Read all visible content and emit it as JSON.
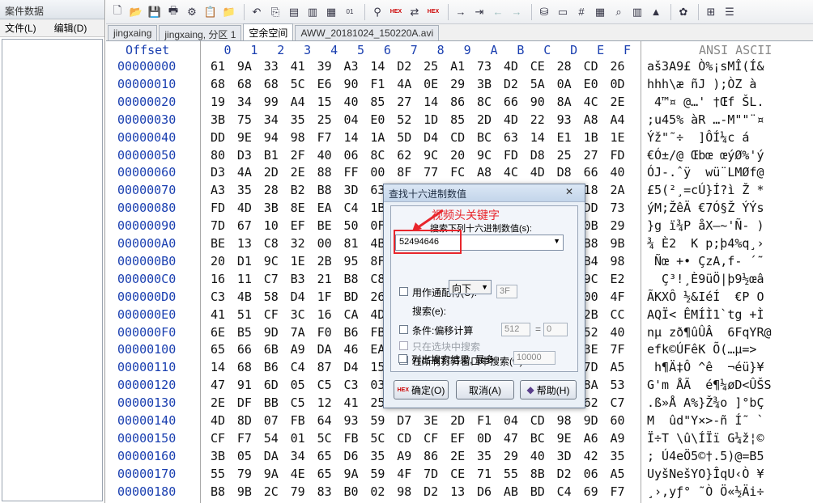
{
  "left_panel": {
    "title": "案件数据",
    "menu": [
      "文件(L)",
      "编辑(D)"
    ]
  },
  "tabs": [
    {
      "label": "jingxaing",
      "active": false
    },
    {
      "label": "jingxaing, 分区 1",
      "active": false
    },
    {
      "label": "空余空间",
      "active": true
    },
    {
      "label": "AWW_20181024_150220A.avi",
      "active": false
    }
  ],
  "hex_view": {
    "offset_header": "Offset",
    "column_headers": [
      "0",
      "1",
      "2",
      "3",
      "4",
      "5",
      "6",
      "7",
      "8",
      "9",
      "A",
      "B",
      "C",
      "D",
      "E",
      "F"
    ],
    "ascii_header": "ANSI ASCII",
    "colors": {
      "offset": "#1a3fb0",
      "header": "#1a3fb0"
    },
    "rows": [
      {
        "offset": "00000000",
        "bytes": [
          "61",
          "9A",
          "33",
          "41",
          "39",
          "A3",
          "14",
          "D2",
          "25",
          "A1",
          "73",
          "4D",
          "CE",
          "28",
          "CD",
          "26"
        ],
        "ascii": "aš3A9£ Ò%¡sMÎ(Í&"
      },
      {
        "offset": "00000010",
        "bytes": [
          "68",
          "68",
          "68",
          "5C",
          "E6",
          "90",
          "F1",
          "4A",
          "0E",
          "29",
          "3B",
          "D2",
          "5A",
          "0A",
          "E0",
          "0D"
        ],
        "ascii": "hhh\\æ ñJ );ÒZ à"
      },
      {
        "offset": "00000020",
        "bytes": [
          "19",
          "34",
          "99",
          "A4",
          "15",
          "40",
          "85",
          "27",
          "14",
          "86",
          "8C",
          "66",
          "90",
          "8A",
          "4C",
          "2E"
        ],
        "ascii": " 4™¤ @…' †Œf ŠL."
      },
      {
        "offset": "00000030",
        "bytes": [
          "3B",
          "75",
          "34",
          "35",
          "25",
          "04",
          "E0",
          "52",
          "1D",
          "85",
          "2D",
          "4D",
          "22",
          "93",
          "A8",
          "A4"
        ],
        "ascii": ";u45% àR …-M\"\"¨¤"
      },
      {
        "offset": "00000040",
        "bytes": [
          "DD",
          "9E",
          "94",
          "98",
          "F7",
          "14",
          "1A",
          "5D",
          "D4",
          "CD",
          "BC",
          "63",
          "14",
          "E1",
          "1B",
          "1E"
        ],
        "ascii": "Ýž\"˜÷  ]ÔÍ¼c á"
      },
      {
        "offset": "00000050",
        "bytes": [
          "80",
          "D3",
          "B1",
          "2F",
          "40",
          "06",
          "8C",
          "62",
          "9C",
          "20",
          "9C",
          "FD",
          "D8",
          "25",
          "27",
          "FD"
        ],
        "ascii": "€Ó±/@ Œbœ œýØ%'ý"
      },
      {
        "offset": "00000060",
        "bytes": [
          "D3",
          "4A",
          "2D",
          "2E",
          "88",
          "FF",
          "00",
          "8F",
          "77",
          "FC",
          "A8",
          "4C",
          "4D",
          "D8",
          "66",
          "40"
        ],
        "ascii": "ÓJ-.ˆÿ  wü¨LMØf@"
      },
      {
        "offset": "00000070",
        "bytes": [
          "A3",
          "35",
          "28",
          "B2",
          "B8",
          "3D",
          "63",
          "",
          "",
          "",
          "",
          "",
          "",
          "",
          "18",
          "2A"
        ],
        "ascii": "£5(²¸=cÚ}Í?ì Ž *"
      },
      {
        "offset": "00000080",
        "bytes": [
          "FD",
          "4D",
          "3B",
          "8E",
          "EA",
          "C4",
          "1B",
          "",
          "",
          "",
          "",
          "",
          "",
          "",
          "DD",
          "73"
        ],
        "ascii": "ýM;ŽêÄ €7Ó§Ž ÝÝs"
      },
      {
        "offset": "00000090",
        "bytes": [
          "7D",
          "67",
          "10",
          "EF",
          "BE",
          "50",
          "0F",
          "",
          "",
          "",
          "",
          "",
          "",
          "",
          "0B",
          "29"
        ],
        "ascii": "}g ï¾P åX–~'Ñ- )"
      },
      {
        "offset": "000000A0",
        "bytes": [
          "BE",
          "13",
          "C8",
          "32",
          "00",
          "81",
          "4B",
          "",
          "",
          "",
          "",
          "",
          "",
          "",
          "B8",
          "9B"
        ],
        "ascii": "¾ È2  K p;þ4%q¸›"
      },
      {
        "offset": "000000B0",
        "bytes": [
          "20",
          "D1",
          "9C",
          "1E",
          "2B",
          "95",
          "8F",
          "",
          "",
          "",
          "",
          "",
          "",
          "",
          "B4",
          "98"
        ],
        "ascii": " Ñœ +• ÇzA,f- ´˜"
      },
      {
        "offset": "000000C0",
        "bytes": [
          "16",
          "11",
          "C7",
          "B3",
          "21",
          "B8",
          "C8",
          "",
          "",
          "",
          "",
          "",
          "",
          "",
          "9C",
          "E2"
        ],
        "ascii": "  Ç³!¸È9üÖ|þ9½œâ"
      },
      {
        "offset": "000000D0",
        "bytes": [
          "C3",
          "4B",
          "58",
          "D4",
          "1F",
          "BD",
          "26",
          "",
          "",
          "",
          "",
          "",
          "",
          "",
          "00",
          "4F"
        ],
        "ascii": "ÃKXÔ ½&IéÍ  €P O"
      },
      {
        "offset": "000000E0",
        "bytes": [
          "41",
          "51",
          "CF",
          "3C",
          "16",
          "CA",
          "4D",
          "",
          "",
          "",
          "",
          "",
          "",
          "",
          "2B",
          "CC"
        ],
        "ascii": "AQÏ< ÊMÍÌ1`tg +Ì"
      },
      {
        "offset": "000000F0",
        "bytes": [
          "6E",
          "B5",
          "9D",
          "7A",
          "F0",
          "B6",
          "FB",
          "",
          "",
          "",
          "",
          "",
          "",
          "",
          "52",
          "40"
        ],
        "ascii": "nµ zð¶ûÛÂ  6FqYR@"
      },
      {
        "offset": "00000100",
        "bytes": [
          "65",
          "66",
          "6B",
          "A9",
          "DA",
          "46",
          "EA",
          "",
          "",
          "",
          "",
          "",
          "",
          "",
          "3E",
          "7F"
        ],
        "ascii": "efk©ÚFêK Õ(…µ=> "
      },
      {
        "offset": "00000110",
        "bytes": [
          "14",
          "68",
          "B6",
          "C4",
          "87",
          "D4",
          "15",
          "",
          "",
          "",
          "",
          "",
          "",
          "",
          "7D",
          "A5"
        ],
        "ascii": " h¶Ä‡Ô ^ê  ¬éü}¥"
      },
      {
        "offset": "00000120",
        "bytes": [
          "47",
          "91",
          "6D",
          "05",
          "C5",
          "C3",
          "03",
          "",
          "",
          "",
          "",
          "",
          "",
          "",
          "8A",
          "53"
        ],
        "ascii": "G'm ÅÃ  é¶¼øD<ÛŠS"
      },
      {
        "offset": "00000130",
        "bytes": [
          "2E",
          "DF",
          "BB",
          "C5",
          "12",
          "41",
          "25",
          "",
          "",
          "",
          "",
          "",
          "",
          "",
          "62",
          "C7"
        ],
        "ascii": ".ß»Å A%}Ž¾o ]°bÇ"
      },
      {
        "offset": "00000140",
        "bytes": [
          "4D",
          "8D",
          "07",
          "FB",
          "64",
          "93",
          "59",
          "D7",
          "3E",
          "2D",
          "F1",
          "04",
          "CD",
          "98",
          "9D",
          "60"
        ],
        "ascii": "M  ûd\"Y×>-ñ Í˜ `"
      },
      {
        "offset": "00000150",
        "bytes": [
          "CF",
          "F7",
          "54",
          "01",
          "5C",
          "FB",
          "5C",
          "CD",
          "CF",
          "EF",
          "0D",
          "47",
          "BC",
          "9E",
          "A6",
          "A9"
        ],
        "ascii": "Ï÷T \\û\\ÍÏï G¼ž¦©"
      },
      {
        "offset": "00000160",
        "bytes": [
          "3B",
          "05",
          "DA",
          "34",
          "65",
          "D6",
          "35",
          "A9",
          "86",
          "2E",
          "35",
          "29",
          "40",
          "3D",
          "42",
          "35"
        ],
        "ascii": "; Ú4eÖ5©†.5)@=B5"
      },
      {
        "offset": "00000170",
        "bytes": [
          "55",
          "79",
          "9A",
          "4E",
          "65",
          "9A",
          "59",
          "4F",
          "7D",
          "CE",
          "71",
          "55",
          "8B",
          "D2",
          "06",
          "A5"
        ],
        "ascii": "UyšNešYO}ÎqU‹Ò ¥"
      },
      {
        "offset": "00000180",
        "bytes": [
          "B8",
          "9B",
          "2C",
          "79",
          "83",
          "B0",
          "02",
          "98",
          "D2",
          "13",
          "D6",
          "AB",
          "BD",
          "C4",
          "69",
          "F7"
        ],
        "ascii": "¸›,yƒ° ˜Ò Ö«½Äi÷"
      }
    ]
  },
  "dialog": {
    "title": "查找十六进制数值",
    "close": "✕",
    "annotation": "视频头关键字",
    "search_label": "搜索下列十六进制数值(s):",
    "search_value": "52494646",
    "wildcard_label": "用作通配符(U):",
    "wildcard_value": "3F",
    "direction_label": "搜索(e):",
    "direction_value": "向下",
    "condition_label": "条件:偏移计算",
    "offset_a": "512",
    "eq": "=",
    "offset_b": "0",
    "selection_only": "只在选块中搜索",
    "all_windows": "在所有打开窗口中搜索(w)",
    "list_results": "列出搜索结果, 最多",
    "max_results": "10000",
    "ok": "确定(O)",
    "cancel": "取消(A)",
    "help": "帮助(H)",
    "ok_icon_text": "HEX"
  },
  "toolbar": {
    "hex_tag": "HEX",
    "icons": [
      "new-file",
      "open-folder",
      "save",
      "print",
      "properties",
      "clipboard-paste",
      "open-disk",
      "undo",
      "copy",
      "copy-block",
      "paste",
      "paste-hex",
      "convert-01",
      "find-binoculars",
      "find-hex",
      "replace",
      "replace-hex",
      "goto",
      "goto-sector",
      "back",
      "forward",
      "disk-tools",
      "ram",
      "hash",
      "calculator",
      "search-text",
      "chart",
      "highlight",
      "settings",
      "window-grid",
      "window-list"
    ]
  }
}
